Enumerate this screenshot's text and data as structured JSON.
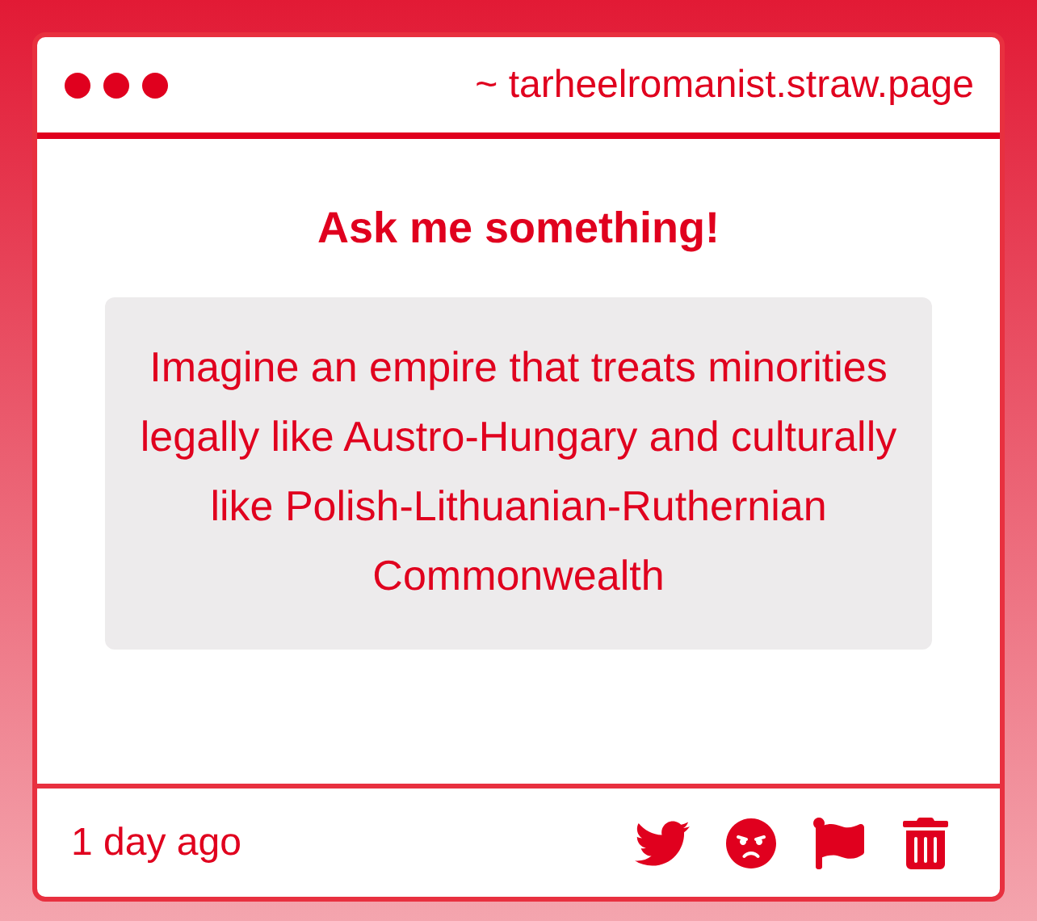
{
  "window": {
    "address": "~ tarheelromanist.straw.page"
  },
  "prompt": "Ask me something!",
  "question": "Imagine an empire that treats minorities legally like Austro-Hungary and culturally like Polish-Lithuanian-Ruthernian Commonwealth",
  "footer": {
    "time": "1 day ago",
    "actions": [
      {
        "kind": "share"
      },
      {
        "kind": "react"
      },
      {
        "kind": "report"
      },
      {
        "kind": "delete"
      }
    ]
  }
}
